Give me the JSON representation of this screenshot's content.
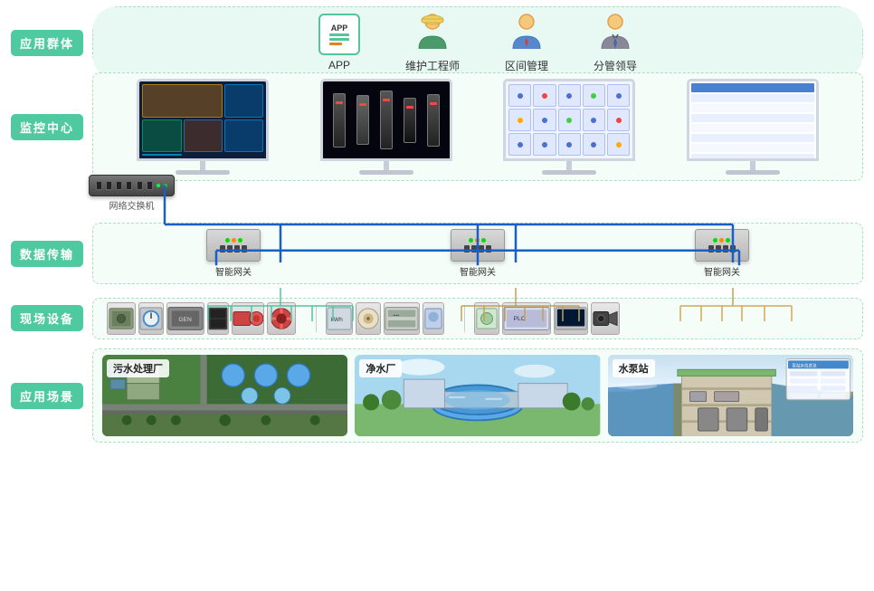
{
  "labels": {
    "row1": "应用群体",
    "row2": "监控中心",
    "row3": "数据传输",
    "row4": "现场设备",
    "row5": "应用场景"
  },
  "users": [
    {
      "id": "app",
      "label": "APP"
    },
    {
      "id": "engineer",
      "label": "维护工程师"
    },
    {
      "id": "zone",
      "label": "区间管理"
    },
    {
      "id": "leader",
      "label": "分管领导"
    }
  ],
  "monitors": [
    {
      "id": "m1",
      "type": "dashboard"
    },
    {
      "id": "m2",
      "type": "equipment"
    },
    {
      "id": "m3",
      "type": "grid"
    },
    {
      "id": "m4",
      "type": "table"
    }
  ],
  "network_switch": {
    "label": "网络交换机"
  },
  "gateways": [
    {
      "id": "gw1",
      "label": "智能网关"
    },
    {
      "id": "gw2",
      "label": "智能网关"
    },
    {
      "id": "gw3",
      "label": "智能网关"
    }
  ],
  "scenes": [
    {
      "id": "sewage",
      "label": "污水处理厂"
    },
    {
      "id": "clean",
      "label": "净水厂"
    },
    {
      "id": "pump",
      "label": "水泵站"
    }
  ]
}
